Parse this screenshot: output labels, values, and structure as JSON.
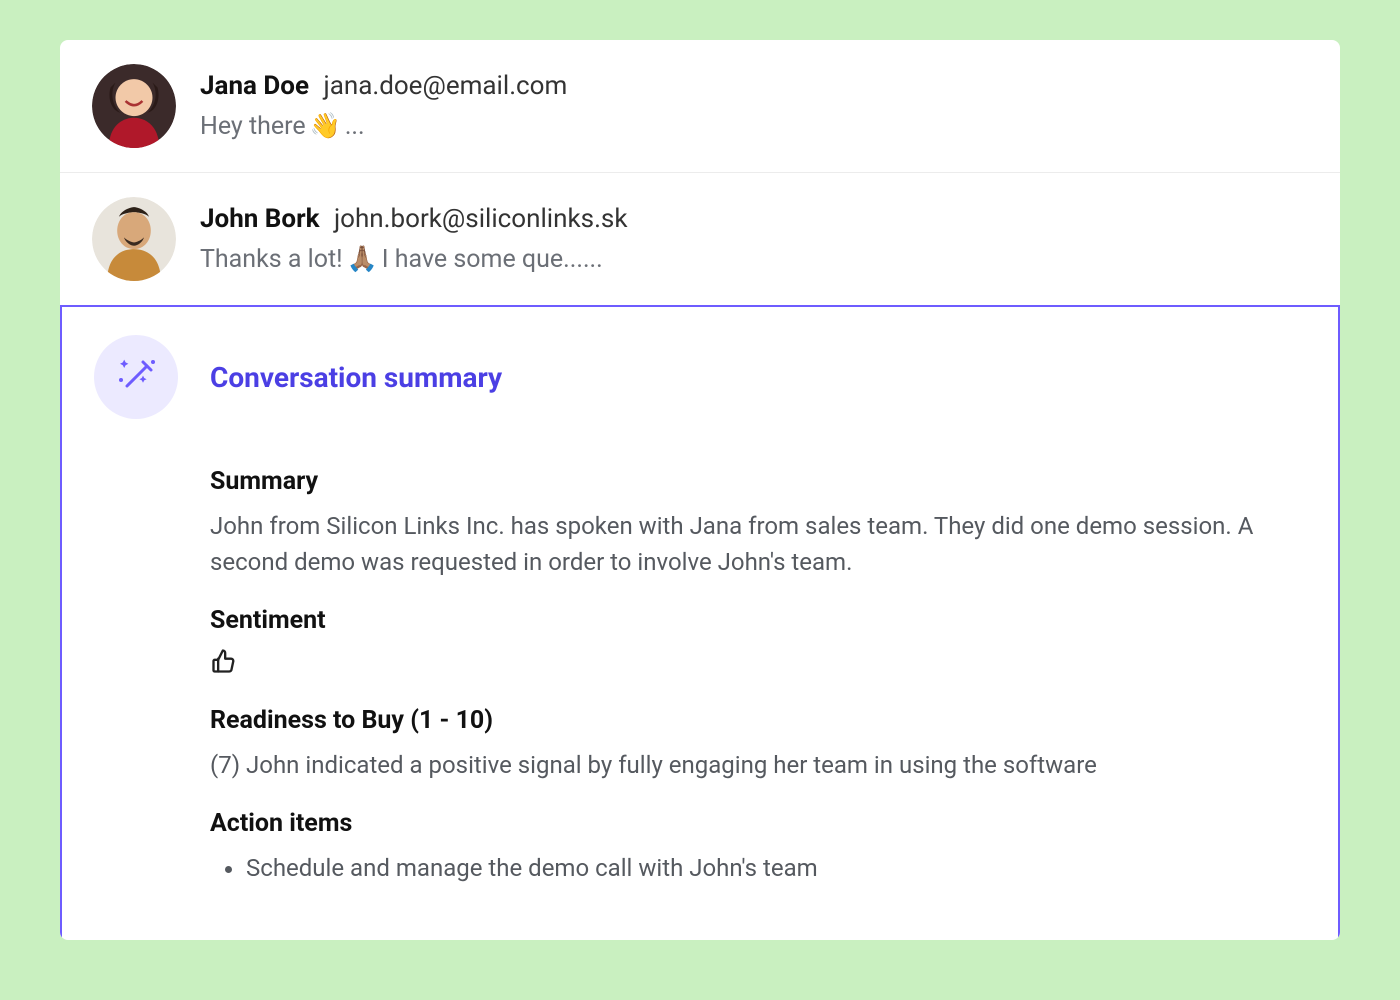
{
  "messages": [
    {
      "name": "Jana Doe",
      "email": "jana.doe@email.com",
      "preview_pre": "Hey there ",
      "preview_emoji": "👋",
      "preview_post": "..."
    },
    {
      "name": "John Bork",
      "email": "john.bork@siliconlinks.sk",
      "preview_pre": "Thanks a lot! ",
      "preview_emoji": "🙏🏽",
      "preview_post": " I have some que......"
    }
  ],
  "summary": {
    "title": "Conversation summary",
    "sections": {
      "summary_heading": "Summary",
      "summary_text": "John from Silicon Links Inc. has spoken with Jana from sales team. They did one demo session. A second demo was requested in order to involve John's team.",
      "sentiment_heading": "Sentiment",
      "sentiment_value": "thumbs-up",
      "readiness_heading": "Readiness to Buy (1 - 10)",
      "readiness_text": "(7) John indicated a positive signal by fully engaging her team in using the software",
      "action_heading": "Action items",
      "action_items": [
        "Schedule and manage the demo call with John's team"
      ]
    }
  }
}
